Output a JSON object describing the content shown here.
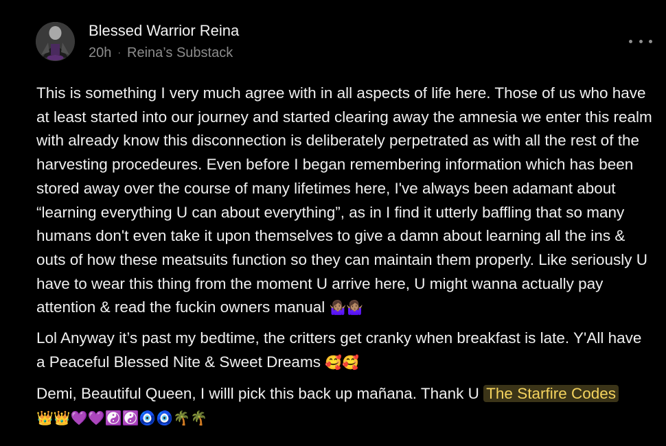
{
  "post": {
    "author": "Blessed Warrior Reina",
    "time": "20h",
    "separator": "·",
    "publication": "Reina’s Substack",
    "more_icon": "ellipsis-horizontal-icon",
    "paragraph1": "This is something I very much agree with in all aspects of life here. Those of us who have at least started into our journey and started clearing away the amnesia we enter this realm with already know this disconnection is deliberately perpetrated as with all the rest of the harvesting procedeures. Even before I began remembering information which has been stored away over the course of many lifetimes here, I've always been adamant about “learning everything U can about everything”, as in I find it utterly baffling that so many humans don't even take it upon themselves to give a damn about learning all the ins & outs of how these meatsuits function so they can maintain them properly. Like seriously U have to wear this thing from the moment U arrive here, U might wanna actually pay attention & read the fuckin owners manual",
    "paragraph1_emoji": "🤷🏽‍♀️🤷🏽‍♀️",
    "paragraph2": "Lol Anyway it’s past my bedtime, the critters get cranky when breakfast is late. Y'All have a Peaceful Blessed Nite & Sweet Dreams",
    "paragraph2_emoji": "🥰🥰",
    "paragraph3": "Demi, Beautiful Queen, I willl pick this back up mañana. Thank U",
    "mention": "The Starfire Codes",
    "paragraph3_emoji": "👑👑💜💜☯️☯️🧿🧿🌴🌴"
  },
  "colors": {
    "background": "#000000",
    "text": "#f0f0f0",
    "meta": "#8c8c8c",
    "mention_text": "#f4d35e",
    "mention_bg": "#3b3418"
  }
}
